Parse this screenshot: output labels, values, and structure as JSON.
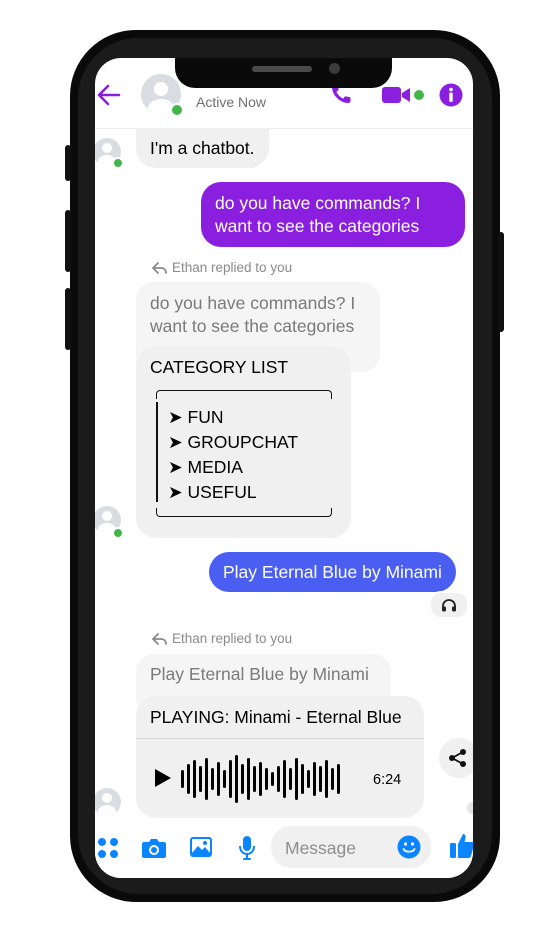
{
  "header": {
    "status": "Active Now",
    "colors": {
      "accent": "#8b1fe0",
      "online": "#44b549"
    },
    "icons": [
      "back-arrow-icon",
      "phone-icon",
      "video-camera-icon",
      "info-icon"
    ]
  },
  "messages": {
    "m1": "I'm a chatbot.",
    "m2": "do you have commands? I want to see the categories",
    "reply1": {
      "note": "Ethan replied to you",
      "quote": "do you have commands? I want to see the categories",
      "title": "CATEGORY LIST",
      "items": [
        "FUN",
        "GROUPCHAT",
        "MEDIA",
        "USEFUL"
      ],
      "bullet": "➤"
    },
    "m3": "Play Eternal Blue by Minami",
    "reaction_icon": "headphones-icon",
    "reply2": {
      "note": "Ethan replied to you",
      "quote": "Play Eternal Blue by Minami",
      "playing": "PLAYING: Minami - Eternal Blue",
      "duration": "6:24"
    }
  },
  "composer": {
    "placeholder": "Message",
    "icons": [
      "menu-dots-icon",
      "camera-icon",
      "image-icon",
      "microphone-icon",
      "emoji-icon",
      "thumbs-up-icon"
    ]
  }
}
